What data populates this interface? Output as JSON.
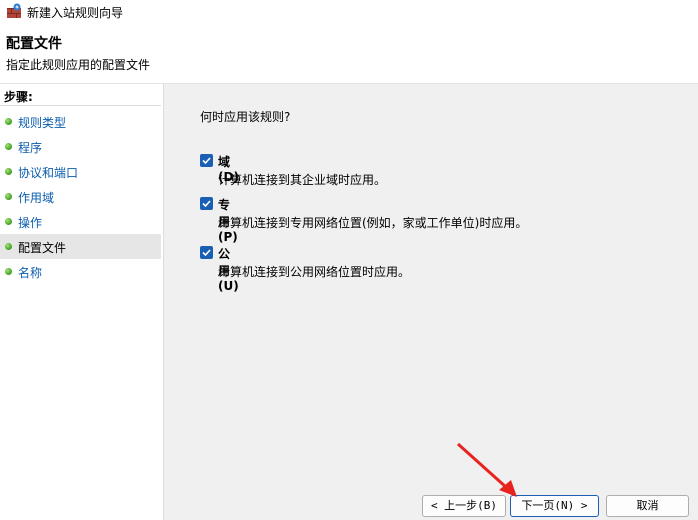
{
  "window": {
    "title": "新建入站规则向导"
  },
  "header": {
    "title": "配置文件",
    "subtitle": "指定此规则应用的配置文件"
  },
  "sidebar": {
    "title": "步骤:",
    "items": [
      {
        "label": "规则类型"
      },
      {
        "label": "程序"
      },
      {
        "label": "协议和端口"
      },
      {
        "label": "作用域"
      },
      {
        "label": "操作"
      },
      {
        "label": "配置文件",
        "current": true
      },
      {
        "label": "名称"
      }
    ]
  },
  "main": {
    "question": "何时应用该规则?",
    "options": [
      {
        "label": "域(D)",
        "description": "计算机连接到其企业域时应用。",
        "checked": true
      },
      {
        "label": "专用(P)",
        "description": "计算机连接到专用网络位置(例如，家或工作单位)时应用。",
        "checked": true
      },
      {
        "label": "公用(U)",
        "description": "计算机连接到公用网络位置时应用。",
        "checked": true
      }
    ]
  },
  "buttons": {
    "back": "< 上一步(B)",
    "next": "下一页(N) >",
    "cancel": "取消"
  },
  "colors": {
    "accent": "#1a5fb4",
    "link": "#0b5cad",
    "arrow": "#e8231f"
  }
}
